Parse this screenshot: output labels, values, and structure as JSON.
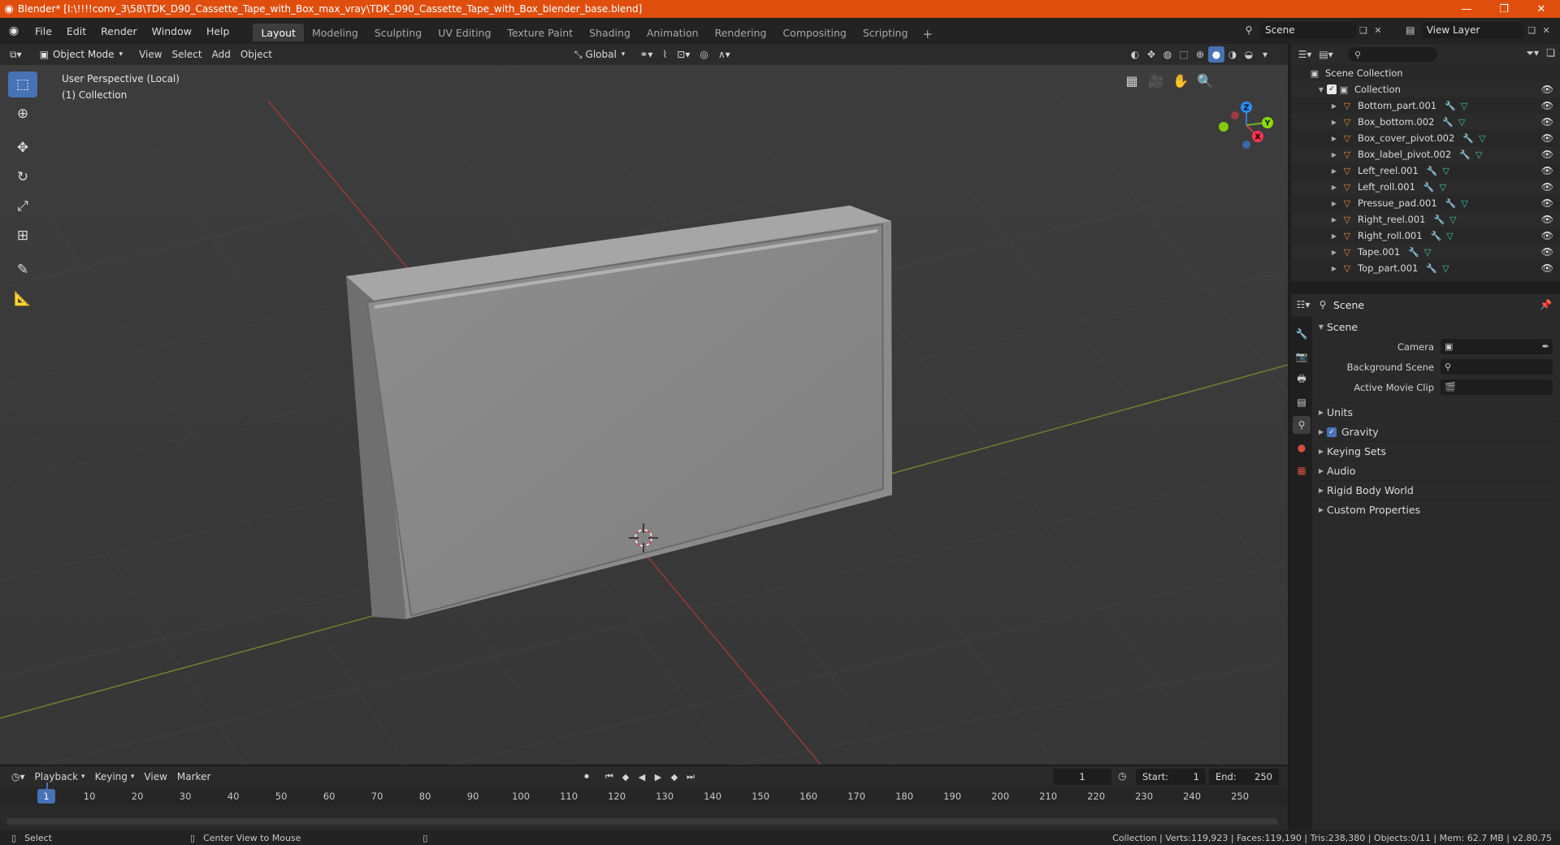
{
  "titlebar": {
    "title": "Blender* [I:\\!!!!conv_3\\58\\TDK_D90_Cassette_Tape_with_Box_max_vray\\TDK_D90_Cassette_Tape_with_Box_blender_base.blend]",
    "minimize": "—",
    "maximize": "❐",
    "close": "✕"
  },
  "menus": [
    "File",
    "Edit",
    "Render",
    "Window",
    "Help"
  ],
  "workspaces": [
    {
      "label": "Layout",
      "active": true
    },
    {
      "label": "Modeling"
    },
    {
      "label": "Sculpting"
    },
    {
      "label": "UV Editing"
    },
    {
      "label": "Texture Paint"
    },
    {
      "label": "Shading"
    },
    {
      "label": "Animation"
    },
    {
      "label": "Rendering"
    },
    {
      "label": "Compositing"
    },
    {
      "label": "Scripting"
    }
  ],
  "scene_selector": {
    "value": "Scene"
  },
  "view_layer_selector": {
    "value": "View Layer"
  },
  "viewport": {
    "mode": "Object Mode",
    "menus": [
      "View",
      "Select",
      "Add",
      "Object"
    ],
    "transform_orientation": "Global",
    "perspective_label": "User Perspective (Local)",
    "collection_label": "(1) Collection",
    "gizmo_axes": [
      "X",
      "Y",
      "Z"
    ]
  },
  "outliner": {
    "root": "Scene Collection",
    "collection": "Collection",
    "objects": [
      "Bottom_part.001",
      "Box_bottom.002",
      "Box_cover_pivot.002",
      "Box_label_pivot.002",
      "Left_reel.001",
      "Left_roll.001",
      "Pressue_pad.001",
      "Right_reel.001",
      "Right_roll.001",
      "Tape.001",
      "Top_part.001"
    ]
  },
  "properties": {
    "context": "Scene",
    "panel_title": "Scene",
    "fields": {
      "camera_label": "Camera",
      "background_scene_label": "Background Scene",
      "active_movie_clip_label": "Active Movie Clip"
    },
    "subpanels": [
      "Units",
      "Gravity",
      "Keying Sets",
      "Audio",
      "Rigid Body World",
      "Custom Properties"
    ]
  },
  "timeline": {
    "menus": [
      "Playback",
      "Keying",
      "View",
      "Marker"
    ],
    "current_frame": "1",
    "start_label": "Start:",
    "start_value": "1",
    "end_label": "End:",
    "end_value": "250",
    "ticks": [
      "10",
      "20",
      "30",
      "40",
      "50",
      "60",
      "70",
      "80",
      "90",
      "100",
      "110",
      "120",
      "130",
      "140",
      "150",
      "160",
      "170",
      "180",
      "190",
      "200",
      "210",
      "220",
      "230",
      "240",
      "250"
    ]
  },
  "statusbar": {
    "left_action": "Select",
    "middle_action": "Center View to Mouse",
    "stats": "Collection | Verts:119,923 | Faces:119,190 | Tris:238,380 | Objects:0/11 | Mem: 62.7 MB | v2.80.75"
  },
  "colors": {
    "accent": "#4772b3",
    "titlebar": "#e04e0e",
    "object_icon": "#e08b3a",
    "mesh_icon": "#3ec9a8",
    "modifier_icon": "#7ba4e8"
  }
}
